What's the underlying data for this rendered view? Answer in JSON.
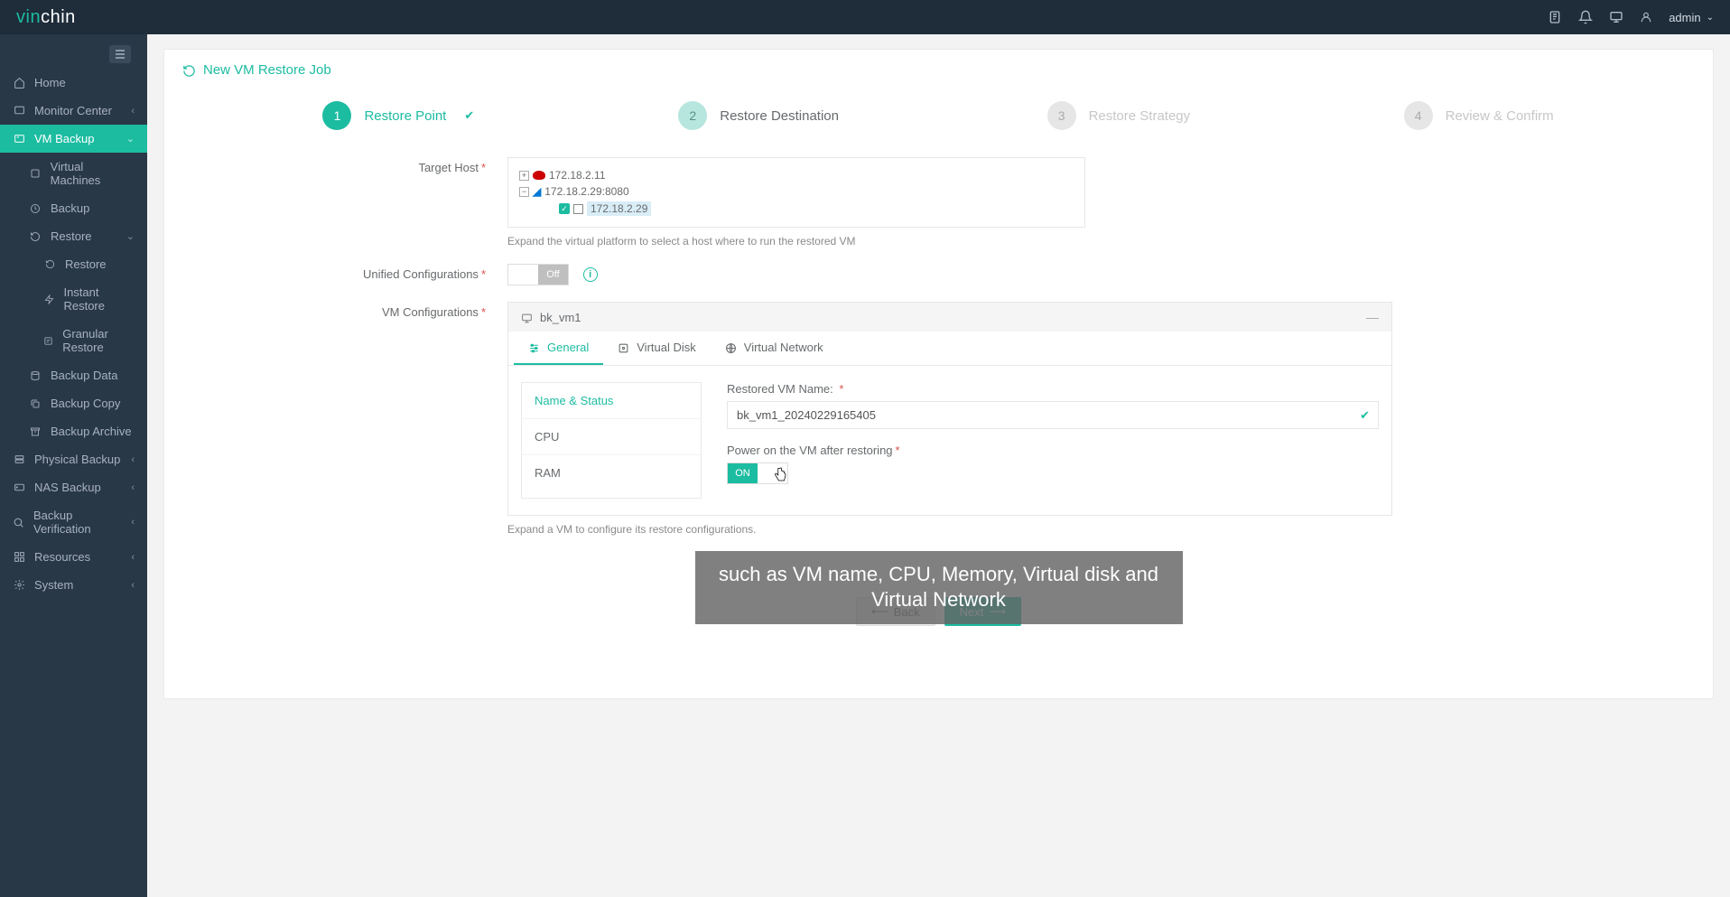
{
  "brand": {
    "part1": "vin",
    "part2": "chin"
  },
  "header": {
    "user_label": "admin"
  },
  "sidebar": {
    "home": "Home",
    "monitor": "Monitor Center",
    "vmbackup": "VM Backup",
    "virtual_machines": "Virtual Machines",
    "backup": "Backup",
    "restore": "Restore",
    "restore_sub": "Restore",
    "instant_restore": "Instant Restore",
    "granular_restore": "Granular Restore",
    "backup_data": "Backup Data",
    "backup_copy": "Backup Copy",
    "backup_archive": "Backup Archive",
    "physical_backup": "Physical Backup",
    "nas_backup": "NAS Backup",
    "backup_verification": "Backup Verification",
    "resources": "Resources",
    "system": "System"
  },
  "panel": {
    "title": "New VM Restore Job"
  },
  "wizard": {
    "step1": {
      "num": "1",
      "label": "Restore Point"
    },
    "step2": {
      "num": "2",
      "label": "Restore Destination"
    },
    "step3": {
      "num": "3",
      "label": "Restore Strategy"
    },
    "step4": {
      "num": "4",
      "label": "Review & Confirm"
    }
  },
  "form": {
    "target_host_label": "Target Host",
    "tree_node1": "172.18.2.11",
    "tree_node2": "172.18.2.29:8080",
    "tree_node3": "172.18.2.29",
    "target_host_hint": "Expand the virtual platform to select a host where to run the restored VM",
    "unified_config_label": "Unified Configurations",
    "unified_toggle_off": "Off",
    "vm_config_label": "VM Configurations",
    "vm_name": "bk_vm1",
    "vm_config_hint": "Expand a VM to configure its restore configurations."
  },
  "vmtabs": {
    "general": "General",
    "virtual_disk": "Virtual Disk",
    "virtual_network": "Virtual Network"
  },
  "vmside": {
    "name_status": "Name & Status",
    "cpu": "CPU",
    "ram": "RAM"
  },
  "vmform": {
    "restored_name_label": "Restored VM Name:",
    "restored_name_value": "bk_vm1_20240229165405",
    "power_on_label": "Power on the VM after restoring",
    "power_on_value": "ON"
  },
  "footer": {
    "back": "Back",
    "next": "Next"
  },
  "caption": "such as VM name, CPU, Memory, Virtual disk and Virtual Network"
}
